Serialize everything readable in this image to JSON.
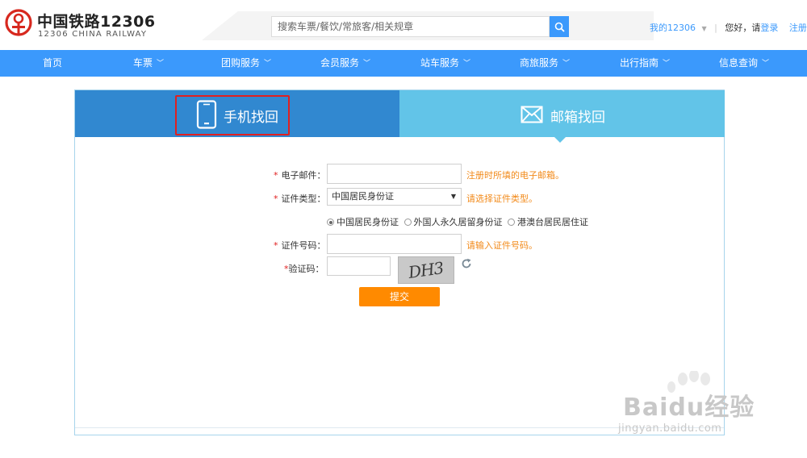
{
  "header": {
    "logo_cn": "中国铁路12306",
    "logo_en": "12306 CHINA RAILWAY",
    "search_placeholder": "搜索车票/餐饮/常旅客/相关规章",
    "my_account": "我的12306",
    "greeting": "您好，请",
    "login": "登录",
    "register": "注册"
  },
  "nav": {
    "items": [
      {
        "label": "首页",
        "has_dropdown": false
      },
      {
        "label": "车票",
        "has_dropdown": true
      },
      {
        "label": "团购服务",
        "has_dropdown": true
      },
      {
        "label": "会员服务",
        "has_dropdown": true
      },
      {
        "label": "站车服务",
        "has_dropdown": true
      },
      {
        "label": "商旅服务",
        "has_dropdown": true
      },
      {
        "label": "出行指南",
        "has_dropdown": true
      },
      {
        "label": "信息查询",
        "has_dropdown": true
      }
    ]
  },
  "tabs": {
    "phone": "手机找回",
    "email": "邮箱找回",
    "active": "email"
  },
  "form": {
    "email_label": "电子邮件：",
    "email_hint": "注册时所填的电子邮箱。",
    "id_type_label": "证件类型：",
    "id_type_value": "中国居民身份证",
    "id_type_hint": "请选择证件类型。",
    "radio_options": [
      {
        "label": "中国居民身份证",
        "checked": true
      },
      {
        "label": "外国人永久居留身份证",
        "checked": false
      },
      {
        "label": "港澳台居民居住证",
        "checked": false
      }
    ],
    "id_number_label": "证件号码：",
    "id_number_hint": "请输入证件号码。",
    "captcha_label": "验证码：",
    "captcha_text": "DH3",
    "submit_label": "提交"
  },
  "watermark": {
    "brand": "Baidu经验",
    "url": "jingyan.baidu.com"
  },
  "colors": {
    "brand_blue": "#3b99fc",
    "tab_dark": "#3188d0",
    "tab_light": "#62c4e8",
    "hint_orange": "#f28a1a",
    "submit_orange": "#ff8a00",
    "required_red": "#e02020"
  }
}
